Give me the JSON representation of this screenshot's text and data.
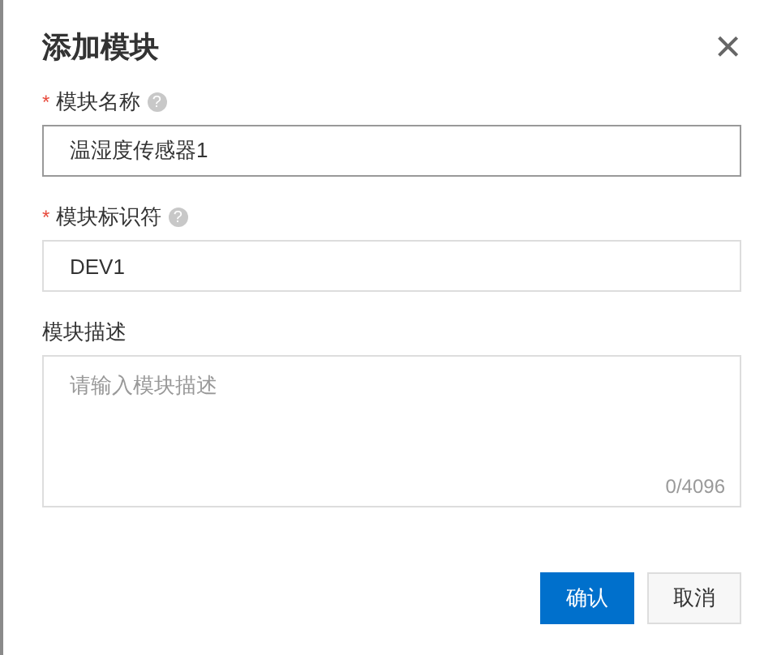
{
  "dialog": {
    "title": "添加模块",
    "close": "×"
  },
  "fields": [
    {
      "kind": "input",
      "required_mark": "*",
      "label": "模块名称",
      "help": "?",
      "value": "温湿度传感器1",
      "focused": true
    },
    {
      "kind": "input",
      "required_mark": "*",
      "label": "模块标识符",
      "help": "?",
      "value": "DEV1",
      "focused": false
    },
    {
      "kind": "textarea",
      "label": "模块描述",
      "placeholder": "请输入模块描述",
      "counter": "0/4096",
      "focused": false
    }
  ],
  "buttons": [
    {
      "label": "确认",
      "primary": true
    },
    {
      "label": "取消",
      "primary": false
    }
  ]
}
